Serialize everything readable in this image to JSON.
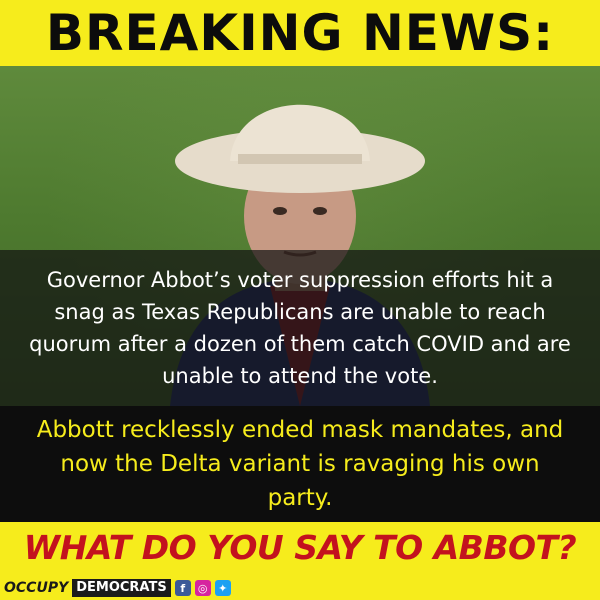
{
  "header": {
    "title": "BREAKING NEWS:"
  },
  "caption": {
    "text": "Governor Abbot’s voter suppression efforts hit a snag as Texas Republicans are unable to reach quorum after a dozen of them catch COVID and are unable to attend the vote."
  },
  "statement": {
    "text": "Abbott recklessly ended mask mandates, and now the Delta variant is ravaging his own party."
  },
  "footer": {
    "question": "WHAT DO YOU SAY TO ABBOT?",
    "brand_occupy": "OCCUPY",
    "brand_democrats": "DEMOCRATS",
    "social_icons": [
      "facebook-icon",
      "instagram-icon",
      "twitter-icon"
    ]
  },
  "colors": {
    "accent_yellow": "#f6ec1c",
    "accent_red": "#c3121e",
    "dark": "#0d0d0d"
  }
}
